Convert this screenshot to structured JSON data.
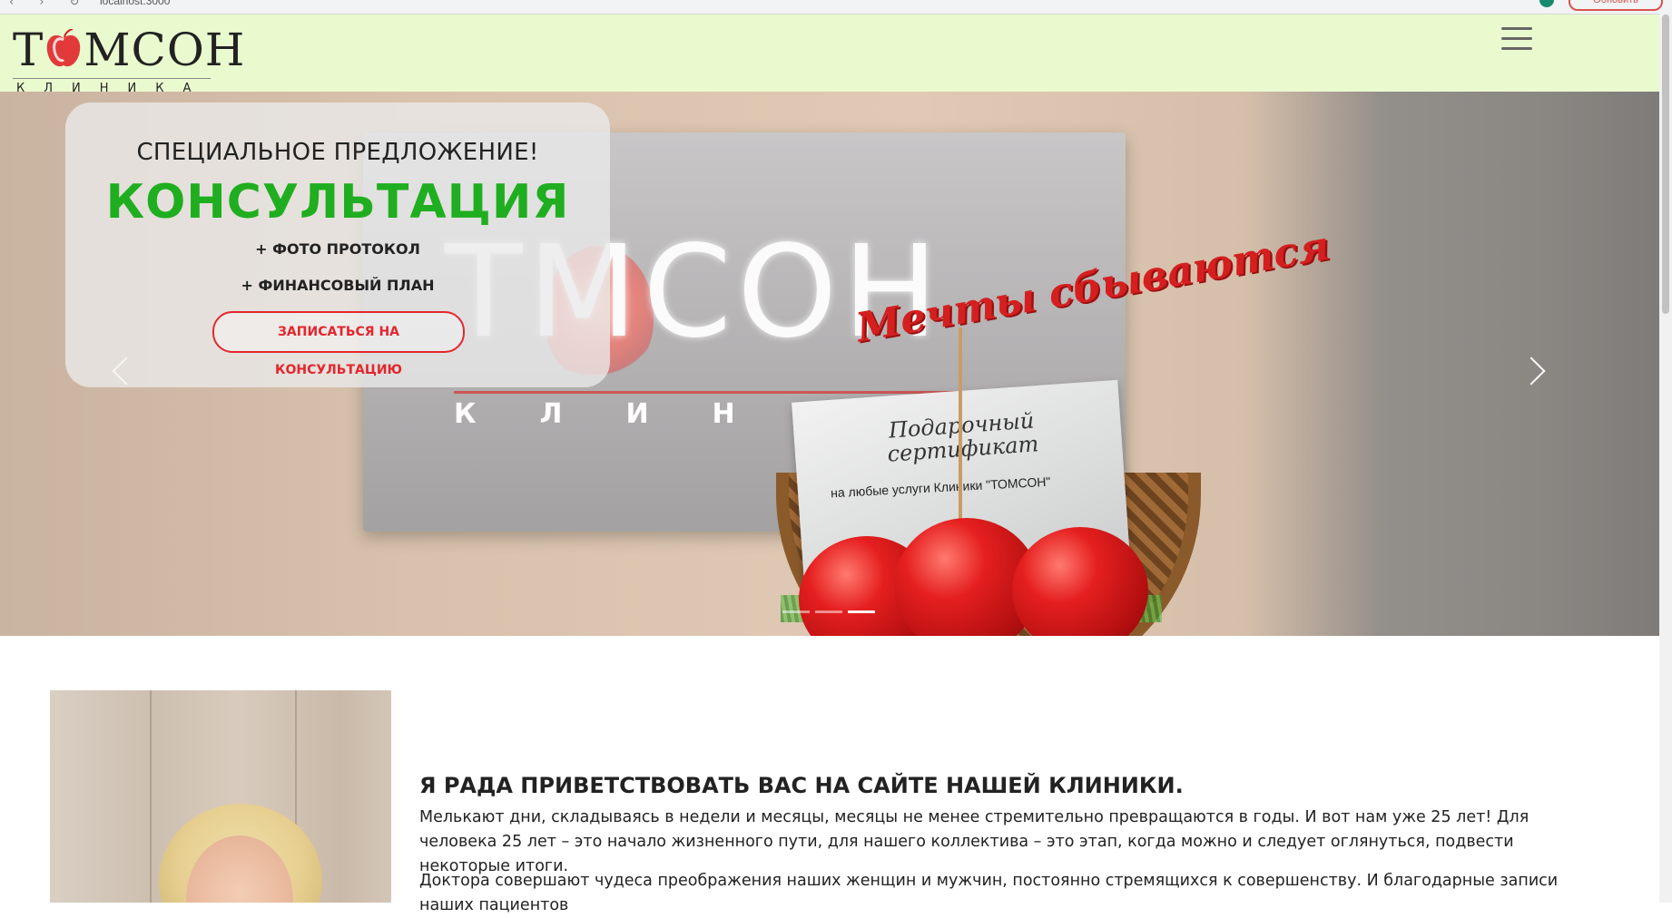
{
  "header": {
    "logo_word_left": "Т",
    "logo_word_right": "МСОН",
    "logo_sub": "КЛИНИКА",
    "menu_icon": "hamburger-icon"
  },
  "hero": {
    "offer": {
      "title": "СПЕЦИАЛЬНОЕ ПРЕДЛОЖЕНИЕ!",
      "main": "КОНСУЛЬТАЦИЯ",
      "line1": "+ ФОТО ПРОТОКОЛ",
      "line2": "+ ФИНАНСОВЫЙ ПЛАН",
      "button": "ЗАПИСАТЬСЯ НА КОНСУЛЬТАЦИЮ"
    },
    "photo": {
      "sign_word": "ТМСОН",
      "sign_sub": "КЛИН",
      "topper": "Мечты сбываются",
      "card_title": "Подарочный сертификат",
      "card_sub": "на любые услуги Клиники \"ТОМСОН\""
    },
    "slides_count": 3,
    "active_slide": 3
  },
  "welcome": {
    "title": "Я РАДА ПРИВЕТСТВОВАТЬ ВАС НА САЙТЕ НАШЕЙ КЛИНИКИ.",
    "p1": "Мелькают дни, складываясь в недели и месяцы, месяцы не менее стремительно превращаются в годы. И вот нам уже 25 лет! Для человека 25 лет – это начало жизненного пути, для нашего коллектива – это этап, когда можно и следует оглянуться, подвести некоторые итоги.",
    "p2": "Доктора совершают чудеса преображения наших женщин и мужчин, постоянно стремящихся к совершенству. И благодарные записи наших пациентов"
  },
  "colors": {
    "header_bg": "#eafacf",
    "accent_green": "#1fae1f",
    "accent_red": "#e3262d"
  }
}
